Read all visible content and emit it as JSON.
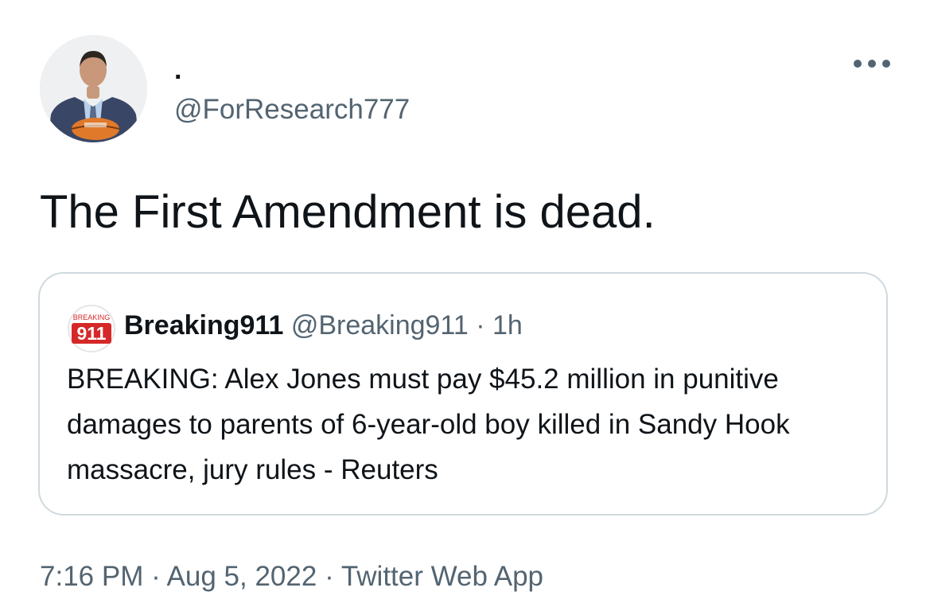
{
  "tweet": {
    "author": {
      "display_name": ".",
      "handle": "@ForResearch777",
      "avatar_icon": "person-avatar"
    },
    "more_icon": "more-horizontal-icon",
    "text": "The First Amendment is dead.",
    "quoted_tweet": {
      "avatar_icon": "breaking911-logo",
      "logo_text_top": "BREAKING",
      "logo_text_main": "911",
      "display_name": "Breaking911",
      "handle": "@Breaking911",
      "separator": "·",
      "time": "1h",
      "text": "BREAKING: Alex Jones must pay $45.2 million in punitive damages to parents of 6-year-old boy killed in Sandy Hook massacre, jury rules - Reuters"
    },
    "meta": {
      "time": "7:16 PM",
      "separator1": "·",
      "date": "Aug 5, 2022",
      "separator2": "·",
      "source": "Twitter Web App"
    }
  },
  "colors": {
    "text_primary": "#0f1419",
    "text_secondary": "#536471",
    "border": "#cfd9de",
    "logo_red": "#d62828"
  }
}
